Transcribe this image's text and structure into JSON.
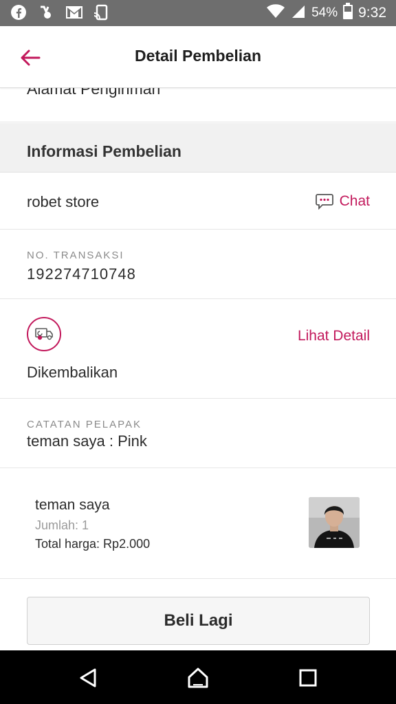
{
  "status_bar": {
    "battery_percent": "54%",
    "time": "9:32",
    "icons_left": [
      "facebook-icon",
      "tv-app-icon",
      "gmail-icon",
      "cast-icon"
    ],
    "icons_right": [
      "wifi-icon",
      "signal-icon",
      "battery-icon"
    ]
  },
  "header": {
    "title": "Detail Pembelian",
    "back_icon": "back-arrow-icon"
  },
  "shipping": {
    "label": "Alamat Pengiriman"
  },
  "purchase_info": {
    "title": "Informasi Pembelian",
    "store_name": "robet store",
    "chat_label": "Chat",
    "transaction_label": "NO. TRANSAKSI",
    "transaction_number": "192274710748",
    "status_label": "Dikembalikan",
    "detail_link": "Lihat Detail",
    "seller_note_label": "CATATAN PELAPAK",
    "seller_note_value": "teman saya : Pink"
  },
  "item": {
    "name": "teman saya",
    "quantity": "Jumlah: 1",
    "total": "Total harga: Rp2.000"
  },
  "actions": {
    "rebuy_label": "Beli Lagi"
  },
  "colors": {
    "accent": "#c2185b",
    "status_bar": "#6e6e6e",
    "nav_bar": "#000000"
  }
}
